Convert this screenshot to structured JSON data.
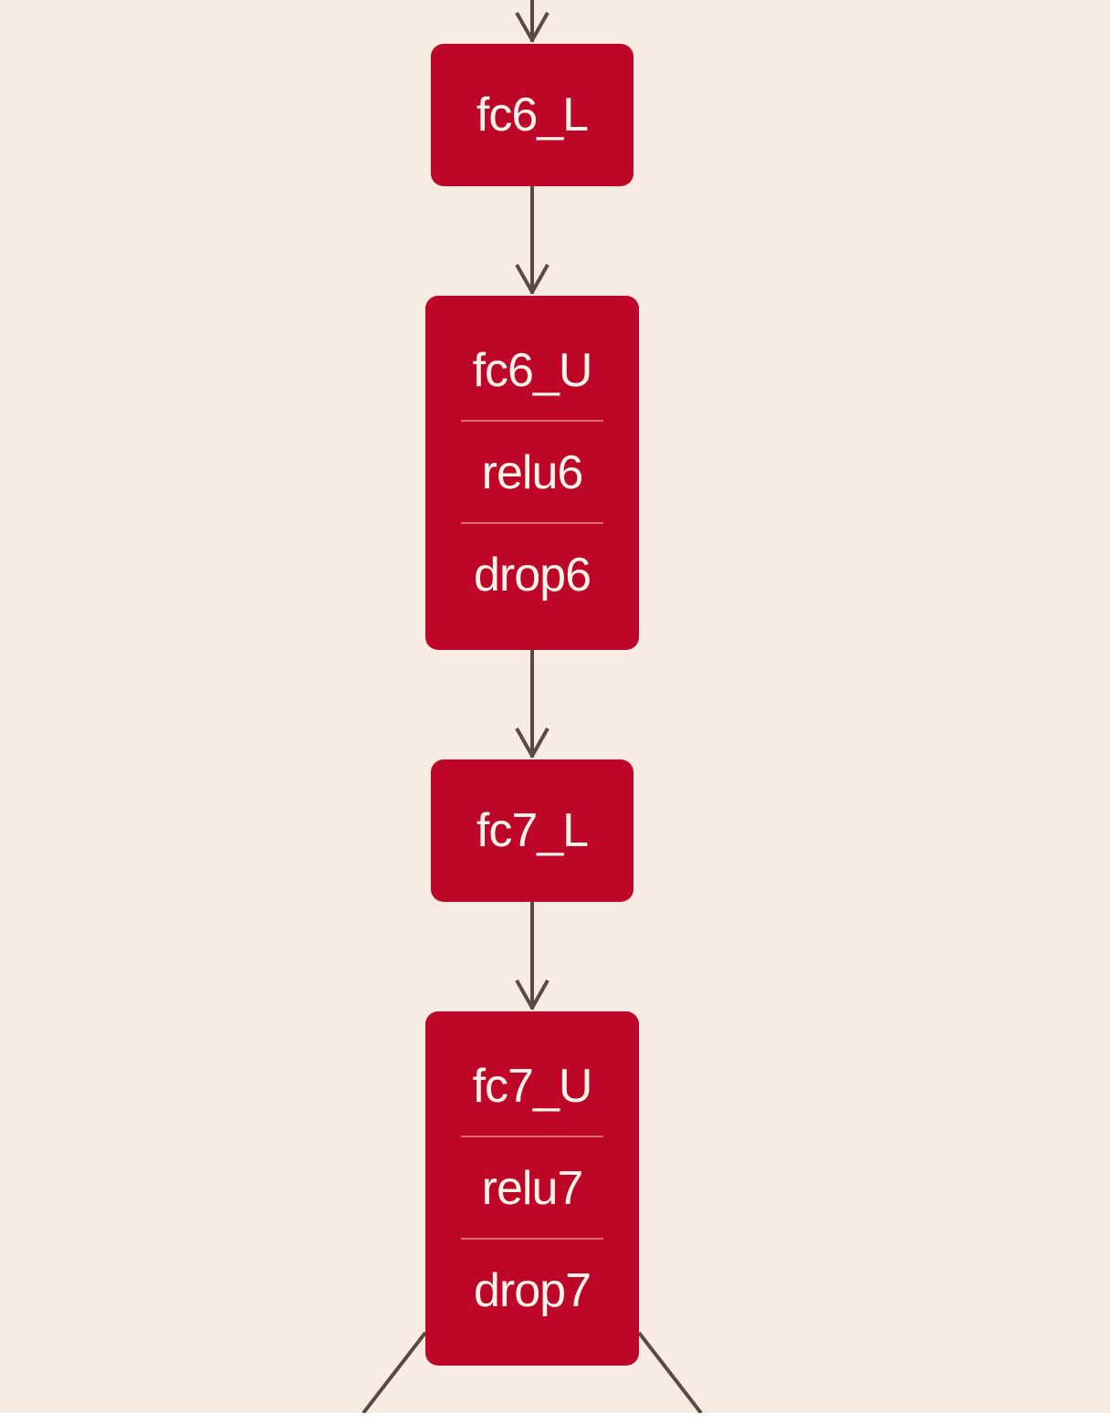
{
  "diagram": {
    "nodes": [
      {
        "id": "fc6_L",
        "labels": [
          "fc6_L"
        ]
      },
      {
        "id": "fc6_U",
        "labels": [
          "fc6_U",
          "relu6",
          "drop6"
        ]
      },
      {
        "id": "fc7_L",
        "labels": [
          "fc7_L"
        ]
      },
      {
        "id": "fc7_U",
        "labels": [
          "fc7_U",
          "relu7",
          "drop7"
        ]
      }
    ],
    "edges": [
      {
        "from": "",
        "to": "fc6_L"
      },
      {
        "from": "fc6_L",
        "to": "fc6_U"
      },
      {
        "from": "fc6_U",
        "to": "fc7_L"
      },
      {
        "from": "fc7_L",
        "to": "fc7_U"
      },
      {
        "from": "fc7_U",
        "to": ""
      },
      {
        "from": "fc7_U",
        "to": ""
      }
    ],
    "colors": {
      "background": "#f7ebe2",
      "node_fill": "#bd0628",
      "node_text": "#fff3ea",
      "separator": "#de6b78",
      "edge": "#5a4a44"
    }
  }
}
